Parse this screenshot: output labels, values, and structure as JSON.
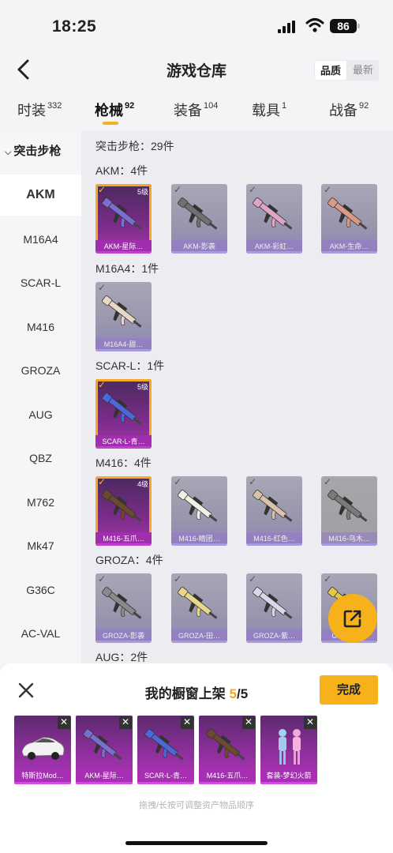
{
  "status_bar": {
    "time": "18:25",
    "battery": "86"
  },
  "header": {
    "title": "游戏仓库",
    "sort_options": [
      "品质",
      "最新"
    ]
  },
  "tabs": [
    {
      "label": "时装",
      "count": "332"
    },
    {
      "label": "枪械",
      "count": "92"
    },
    {
      "label": "装备",
      "count": "104"
    },
    {
      "label": "载具",
      "count": "1"
    },
    {
      "label": "战备",
      "count": "92"
    }
  ],
  "sidebar": {
    "category": "突击步枪",
    "items": [
      "AKM",
      "M16A4",
      "SCAR-L",
      "M416",
      "GROZA",
      "AUG",
      "QBZ",
      "M762",
      "Mk47",
      "G36C",
      "AC-VAL"
    ]
  },
  "content": {
    "summary": "突击步枪：29件",
    "groups": [
      {
        "name": "AKM：4件",
        "items": [
          {
            "label": "AKM-星际…",
            "level": "5级",
            "selected": true,
            "color": "#7a6fd0"
          },
          {
            "label": "AKM-影袭",
            "selected": false,
            "color": "#707070"
          },
          {
            "label": "AKM-彩虹…",
            "selected": false,
            "color": "#e0a4c8"
          },
          {
            "label": "AKM-生命…",
            "selected": false,
            "color": "#d99a86"
          }
        ]
      },
      {
        "name": "M16A4：1件",
        "items": [
          {
            "label": "M16A4-甜…",
            "selected": false,
            "color": "#e8d6c6"
          }
        ]
      },
      {
        "name": "SCAR-L：1件",
        "items": [
          {
            "label": "SCAR-L-青…",
            "level": "5级",
            "selected": true,
            "color": "#4a68d8"
          }
        ]
      },
      {
        "name": "M416：4件",
        "items": [
          {
            "label": "M416-五爪…",
            "level": "4级",
            "selected": true,
            "color": "#6b4a2e"
          },
          {
            "label": "M416-睛团…",
            "selected": false,
            "color": "#f2efe7"
          },
          {
            "label": "M416-红色…",
            "selected": false,
            "color": "#d8c2ae"
          },
          {
            "label": "M416-乌木…",
            "selected": false,
            "color": "#7a7a7a",
            "gray": true
          }
        ]
      },
      {
        "name": "GROZA：4件",
        "items": [
          {
            "label": "GROZA-影袭",
            "selected": false,
            "color": "#8a8a8a"
          },
          {
            "label": "GROZA-田…",
            "selected": false,
            "color": "#e6d88a"
          },
          {
            "label": "GROZA-紫…",
            "selected": false,
            "color": "#d8d8e8"
          },
          {
            "label": "GROZA-…",
            "selected": false,
            "color": "#e2c84a"
          }
        ]
      },
      {
        "name": "AUG：2件",
        "items": []
      }
    ]
  },
  "sheet": {
    "title_prefix": "我的橱窗上架",
    "count_current": "5",
    "count_total": "/5",
    "done_label": "完成",
    "slots": [
      {
        "label": "特斯拉Mod…",
        "kind": "car"
      },
      {
        "label": "AKM-星际…",
        "kind": "gun",
        "color": "#7a6fd0"
      },
      {
        "label": "SCAR-L-青…",
        "kind": "gun",
        "color": "#4a68d8"
      },
      {
        "label": "M416-五爪…",
        "kind": "gun",
        "color": "#6b4a2e"
      },
      {
        "label": "套装-梦幻火箭",
        "kind": "suit"
      }
    ],
    "hint": "拖拽/长按可调整资产物品顺序"
  }
}
